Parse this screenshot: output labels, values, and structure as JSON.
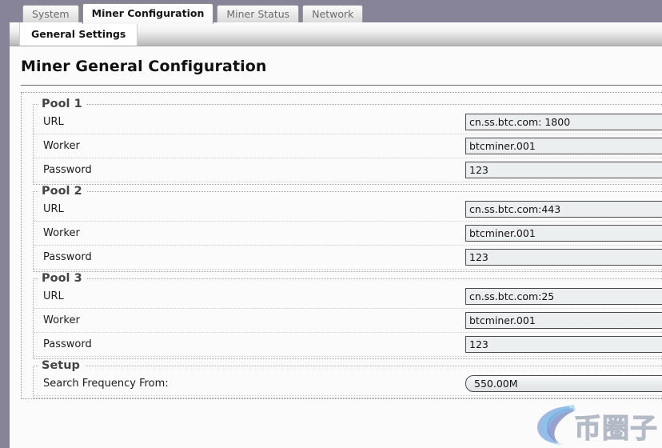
{
  "window": {
    "chrome_color": "#878499",
    "page_background": "#fbfbfb"
  },
  "tabs": [
    {
      "label": "System",
      "active": false
    },
    {
      "label": "Miner Configuration",
      "active": true
    },
    {
      "label": "Miner Status",
      "active": false
    },
    {
      "label": "Network",
      "active": false
    }
  ],
  "subtabs": [
    {
      "label": "General Settings",
      "active": true
    }
  ],
  "main": {
    "title": "Miner General Configuration",
    "sections": [
      {
        "legend": "Pool 1",
        "rows": [
          {
            "label": "URL",
            "value": "cn.ss.btc.com: 1800",
            "control": "text"
          },
          {
            "label": "Worker",
            "value": "btcminer.001",
            "control": "text"
          },
          {
            "label": "Password",
            "value": "123",
            "control": "text"
          }
        ]
      },
      {
        "legend": "Pool 2",
        "rows": [
          {
            "label": "URL",
            "value": "cn.ss.btc.com:443",
            "control": "text"
          },
          {
            "label": "Worker",
            "value": "btcminer.001",
            "control": "text"
          },
          {
            "label": "Password",
            "value": "123",
            "control": "text"
          }
        ]
      },
      {
        "legend": "Pool 3",
        "rows": [
          {
            "label": "URL",
            "value": "cn.ss.btc.com:25",
            "control": "text"
          },
          {
            "label": "Worker",
            "value": "btcminer.001",
            "control": "text"
          },
          {
            "label": "Password",
            "value": "123",
            "control": "text"
          }
        ]
      },
      {
        "legend": "Setup",
        "rows": [
          {
            "label": "Search Frequency From:",
            "value": "550.00M",
            "control": "select"
          }
        ]
      }
    ]
  },
  "watermark": {
    "text": "币圈子",
    "logo_icon": "swoosh-circle-icon",
    "color": "#b9c2cc",
    "accent": "#6a7fc2"
  }
}
